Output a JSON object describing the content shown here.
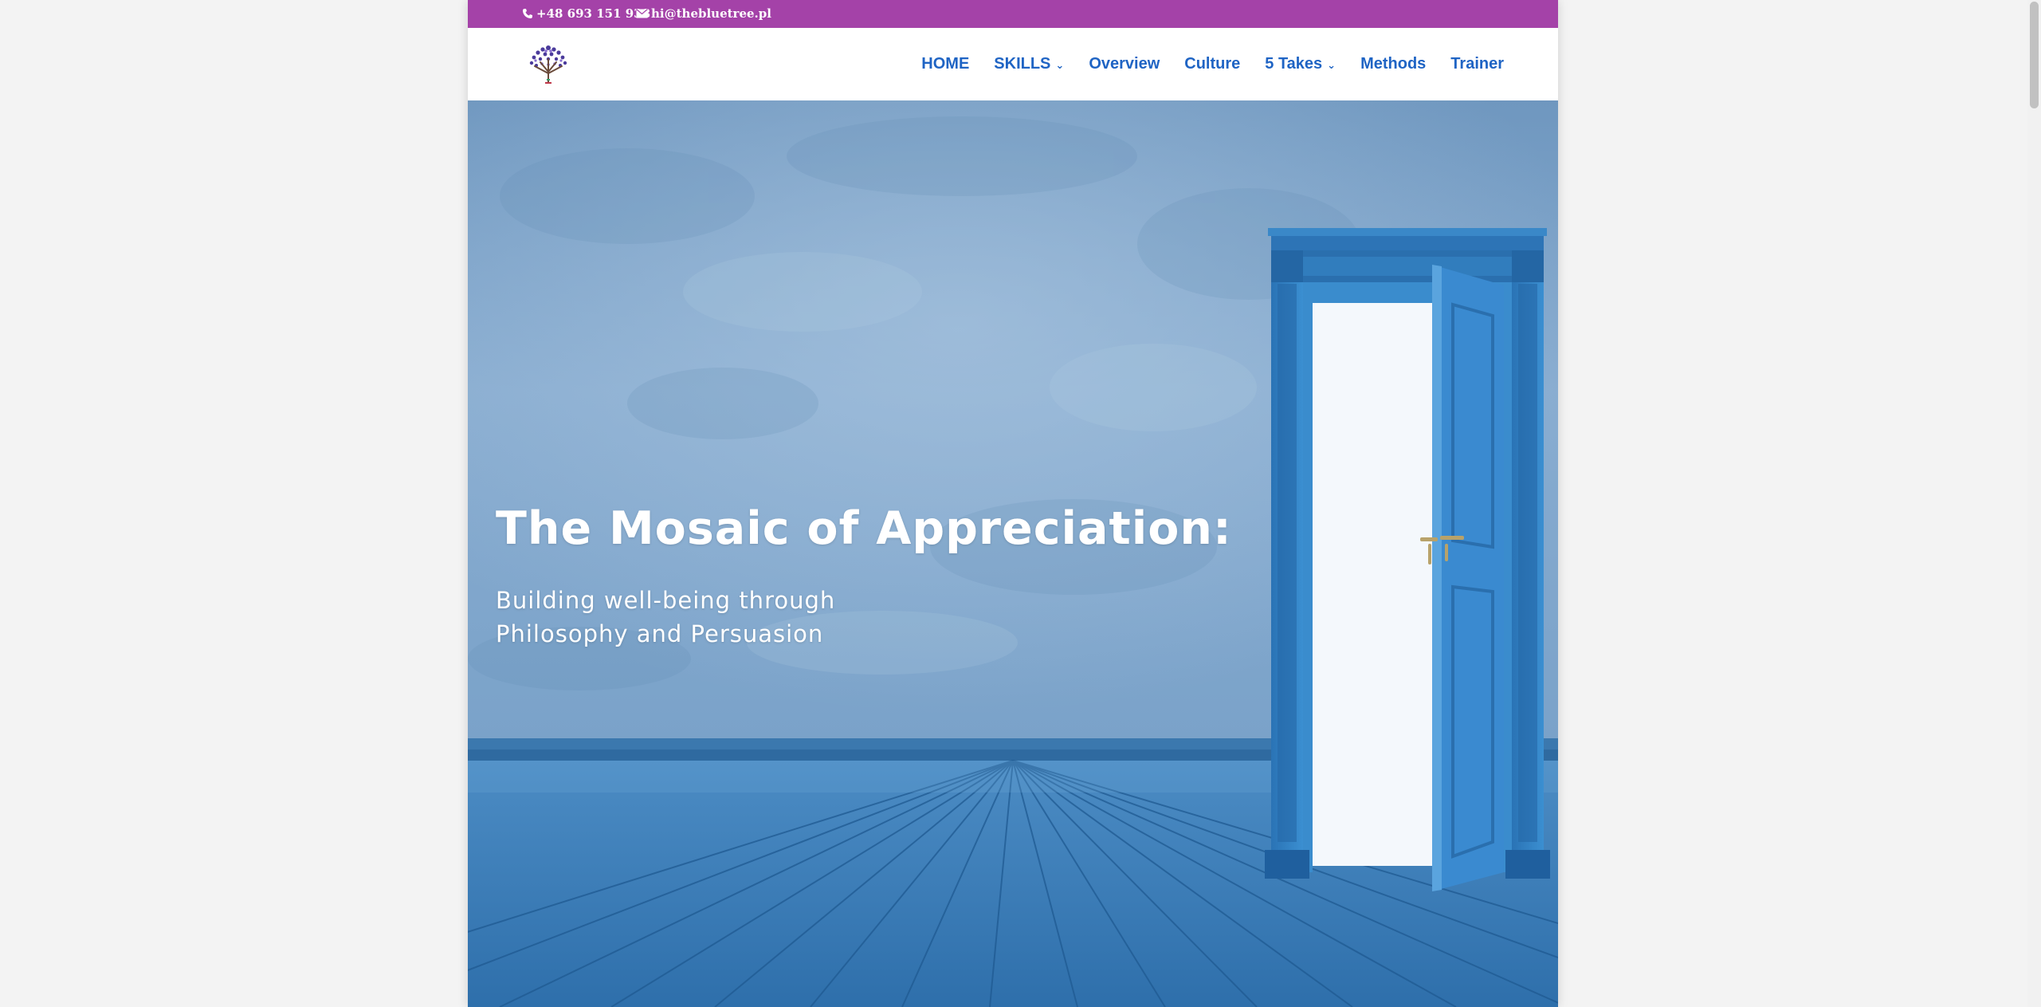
{
  "topbar": {
    "phone": "+48 693 151 938",
    "email": "hi@thebluetree.pl"
  },
  "header": {
    "logo_icon": "tree-logo-icon",
    "nav": [
      {
        "label": "HOME",
        "has_dropdown": false
      },
      {
        "label": "SKILLS",
        "has_dropdown": true
      },
      {
        "label": "Overview",
        "has_dropdown": false
      },
      {
        "label": "Culture",
        "has_dropdown": false
      },
      {
        "label": "5 Takes",
        "has_dropdown": true
      },
      {
        "label": "Methods",
        "has_dropdown": false
      },
      {
        "label": "Trainer",
        "has_dropdown": false
      }
    ]
  },
  "hero": {
    "title": "The Mosaic of Appreciation:",
    "subtitle": "Building well-being through Philosophy and Persuasion"
  },
  "colors": {
    "topbar": "#a442a8",
    "nav_link": "#1f64c4",
    "wall": "#7fa5c9",
    "floor": "#3a7bb5",
    "door": "#2f7fc1"
  }
}
